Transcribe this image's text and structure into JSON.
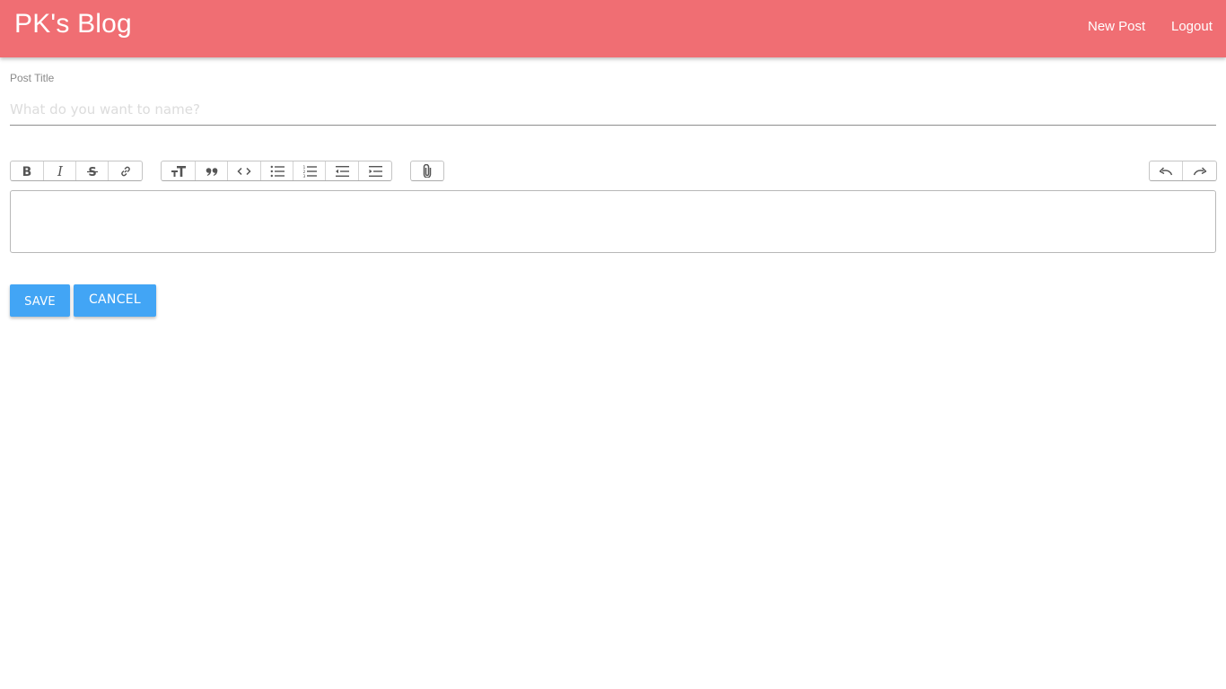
{
  "header": {
    "brand": "PK's Blog",
    "nav": [
      {
        "label": "New Post"
      },
      {
        "label": "Logout"
      }
    ],
    "background_color": "#f06e73"
  },
  "form": {
    "title_label": "Post Title",
    "title_value": "",
    "title_placeholder": "What do you want to name?",
    "editor_content": ""
  },
  "toolbar": {
    "groups": [
      {
        "name": "text-format",
        "buttons": [
          "bold-icon",
          "italic-icon",
          "strikethrough-icon",
          "link-icon"
        ]
      },
      {
        "name": "block-format",
        "buttons": [
          "heading-icon",
          "quote-icon",
          "code-icon",
          "bullet-list-icon",
          "numbered-list-icon",
          "decrease-indent-icon",
          "increase-indent-icon"
        ]
      },
      {
        "name": "attachments",
        "buttons": [
          "paperclip-icon"
        ]
      },
      {
        "name": "history",
        "buttons": [
          "undo-icon",
          "redo-icon"
        ]
      }
    ]
  },
  "actions": {
    "save_label": "Save",
    "cancel_label": "Cancel",
    "button_color": "#42a5f5"
  }
}
